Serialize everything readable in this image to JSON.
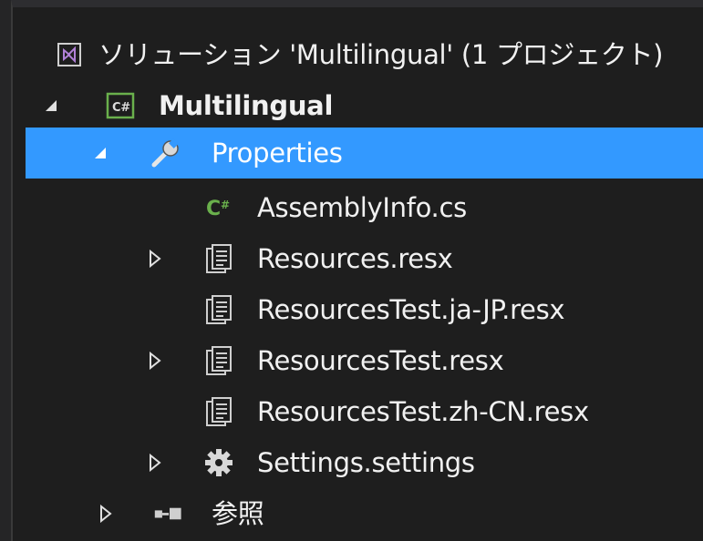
{
  "solution": {
    "label": "ソリューション 'Multilingual' (1 プロジェクト)",
    "icon": "visual-studio-solution-icon"
  },
  "project": {
    "label": "Multilingual",
    "icon": "csharp-project-icon"
  },
  "items": [
    {
      "label": "Properties",
      "icon": "wrench-icon",
      "expanded": true,
      "selected": true
    },
    {
      "label": "AssemblyInfo.cs",
      "icon": "csharp-file-icon"
    },
    {
      "label": "Resources.resx",
      "icon": "resource-file-icon",
      "collapsed": true
    },
    {
      "label": "ResourcesTest.ja-JP.resx",
      "icon": "resource-file-icon"
    },
    {
      "label": "ResourcesTest.resx",
      "icon": "resource-file-icon",
      "collapsed": true
    },
    {
      "label": "ResourcesTest.zh-CN.resx",
      "icon": "resource-file-icon"
    },
    {
      "label": "Settings.settings",
      "icon": "gear-icon",
      "collapsed": true
    },
    {
      "label": "参照",
      "icon": "references-icon",
      "collapsed": true
    }
  ],
  "colors": {
    "background": "#1e1e1e",
    "selection": "#3399ff",
    "text": "#f1f1f1",
    "vs_purple": "#b180d7",
    "csharp_green": "#6ab04c"
  }
}
